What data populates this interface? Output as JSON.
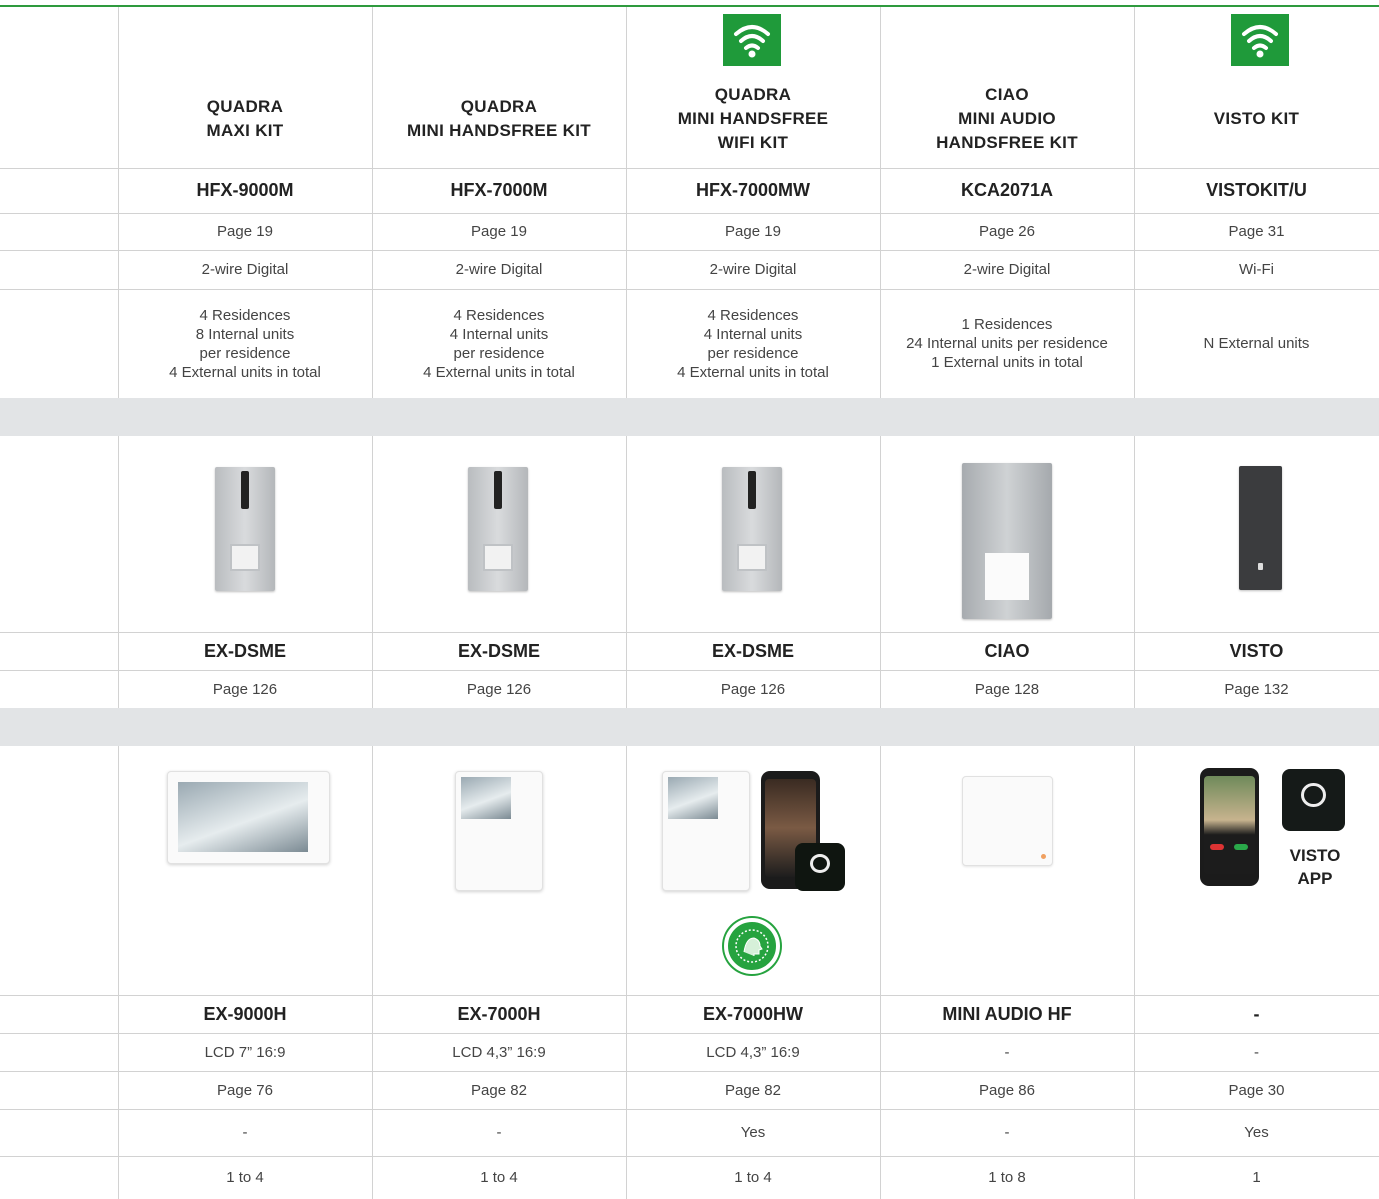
{
  "columns": [
    {
      "title_lines": [
        "QUADRA",
        "MAXI KIT"
      ],
      "wifi": false,
      "kit_code": "HFX-9000M",
      "kit_page": "Page 19",
      "technology": "2-wire Digital",
      "capacity_lines": [
        "4 Residences",
        "8 Internal units",
        "per residence",
        "4 External units in total"
      ],
      "external_name": "EX-DSME",
      "external_page": "Page 126",
      "internal_name": "EX-9000H",
      "display": "LCD 7” 16:9",
      "internal_page": "Page 76",
      "app": "-",
      "expandable": "1 to 4"
    },
    {
      "title_lines": [
        "QUADRA",
        "MINI HANDSFREE KIT"
      ],
      "wifi": false,
      "kit_code": "HFX-7000M",
      "kit_page": "Page 19",
      "technology": "2-wire Digital",
      "capacity_lines": [
        "4 Residences",
        "4 Internal units",
        "per residence",
        "4 External units in total"
      ],
      "external_name": "EX-DSME",
      "external_page": "Page 126",
      "internal_name": "EX-7000H",
      "display": "LCD 4,3” 16:9",
      "internal_page": "Page 82",
      "app": "-",
      "expandable": "1 to 4"
    },
    {
      "title_lines": [
        "QUADRA",
        "MINI HANDSFREE",
        "WIFI KIT"
      ],
      "wifi": true,
      "kit_code": "HFX-7000MW",
      "kit_page": "Page 19",
      "technology": "2-wire Digital",
      "capacity_lines": [
        "4 Residences",
        "4 Internal units",
        "per residence",
        "4 External units in total"
      ],
      "external_name": "EX-DSME",
      "external_page": "Page 126",
      "internal_name": "EX-7000HW",
      "display": "LCD 4,3” 16:9",
      "internal_page": "Page 82",
      "app": "Yes",
      "expandable": "1 to 4"
    },
    {
      "title_lines": [
        "CIAO",
        "MINI AUDIO",
        "HANDSFREE KIT"
      ],
      "wifi": false,
      "kit_code": "KCA2071A",
      "kit_page": "Page 26",
      "technology": "2-wire Digital",
      "capacity_lines": [
        "1 Residences",
        "24 Internal units per residence",
        "1 External units in total"
      ],
      "external_name": "CIAO",
      "external_page": "Page 128",
      "internal_name": "MINI AUDIO HF",
      "display": "-",
      "internal_page": "Page 86",
      "app": "-",
      "expandable": "1 to 8"
    },
    {
      "title_lines": [
        "VISTO KIT"
      ],
      "wifi": true,
      "kit_code": "VISTOKIT/U",
      "kit_page": "Page 31",
      "technology": "Wi-Fi",
      "capacity_lines": [
        "N External units"
      ],
      "external_name": "VISTO",
      "external_page": "Page 132",
      "internal_name": "-",
      "display": "-",
      "internal_page": "Page 30",
      "app": "Yes",
      "expandable": "1"
    }
  ],
  "visto_app_label": [
    "VISTO",
    "APP"
  ],
  "icons": {
    "wifi": "wifi-icon",
    "face_recognition": "face-recognition-badge",
    "app": "app-icon"
  },
  "colors": {
    "accent_green": "#1f9a3a",
    "band_grey": "#e2e4e6",
    "grid": "#d2d2d2"
  }
}
